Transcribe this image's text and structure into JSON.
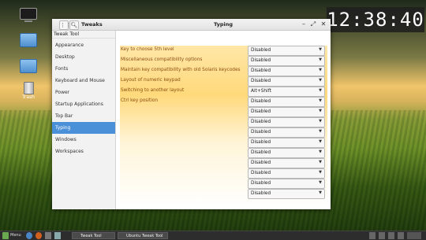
{
  "desktop": {
    "icons": [
      {
        "label": "",
        "icon": "computer-icon"
      },
      {
        "label": "",
        "icon": "folder-icon"
      },
      {
        "label": "",
        "icon": "folder-icon"
      },
      {
        "label": "Trash",
        "icon": "trash-icon"
      }
    ],
    "clock": "12:38:40"
  },
  "window": {
    "app_title": "Tweaks",
    "page_title": "Typing",
    "sidebar_header": "Tweak Tool",
    "sidebar": [
      {
        "label": "Appearance",
        "active": false
      },
      {
        "label": "Desktop",
        "active": false
      },
      {
        "label": "Fonts",
        "active": false
      },
      {
        "label": "Keyboard and Mouse",
        "active": false
      },
      {
        "label": "Power",
        "active": false
      },
      {
        "label": "Startup Applications",
        "active": false
      },
      {
        "label": "Top Bar",
        "active": false
      },
      {
        "label": "Typing",
        "active": true
      },
      {
        "label": "Windows",
        "active": false
      },
      {
        "label": "Workspaces",
        "active": false
      }
    ],
    "settings": [
      {
        "label": "Key to choose 5th level",
        "value": "Disabled"
      },
      {
        "label": "Miscellaneous compatibility options",
        "value": "Disabled"
      },
      {
        "label": "Maintain key compatibility with old Solaris keycodes",
        "value": "Disabled"
      },
      {
        "label": "Layout of numeric keypad",
        "value": "Disabled"
      },
      {
        "label": "Switching to another layout",
        "value": "Alt+Shift"
      },
      {
        "label": "Ctrl key position",
        "value": "Disabled"
      },
      {
        "label": "",
        "value": "Disabled"
      },
      {
        "label": "",
        "value": "Disabled"
      },
      {
        "label": "",
        "value": "Disabled"
      },
      {
        "label": "",
        "value": "Disabled"
      },
      {
        "label": "",
        "value": "Disabled"
      },
      {
        "label": "",
        "value": "Disabled"
      },
      {
        "label": "",
        "value": "Disabled"
      },
      {
        "label": "",
        "value": "Disabled"
      },
      {
        "label": "",
        "value": "Disabled"
      }
    ]
  },
  "taskbar": {
    "menu_label": "Menu",
    "tasks": [
      "Tweak Tool",
      "Ubuntu Tweak Tool"
    ]
  },
  "colors": {
    "accent": "#4a90d9",
    "label_text": "#8b4d12"
  }
}
